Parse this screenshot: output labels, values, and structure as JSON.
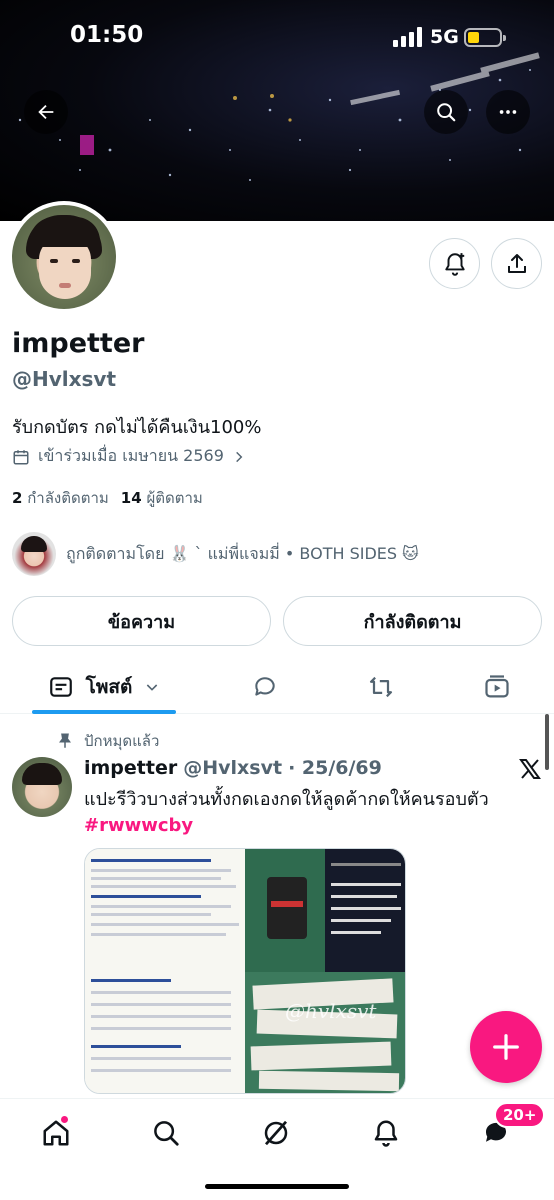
{
  "status_bar": {
    "time": "01:50",
    "network": "5G"
  },
  "profile": {
    "display_name": "impetter",
    "handle": "@Hvlxsvt",
    "bio": "รับกดบัตร กดไม่ได้คืนเงิน100%",
    "joined": "เข้าร่วมเมื่อ เมษายน 2569",
    "following_count": "2",
    "following_label": "กำลังติดตาม",
    "followers_count": "14",
    "followers_label": "ผู้ติดตาม",
    "followed_by": "ถูกติดตามโดย 🐰 ` แม่พี่แจมมี่ • BOTH SIDES 🐱"
  },
  "actions": {
    "message_label": "ข้อความ",
    "following_button_label": "กำลังติดตาม"
  },
  "tabs": [
    {
      "label": "โพสต์",
      "icon": "posts-icon",
      "active": true
    },
    {
      "label": "",
      "icon": "replies-icon"
    },
    {
      "label": "",
      "icon": "reposts-icon"
    },
    {
      "label": "",
      "icon": "media-icon"
    }
  ],
  "pinned_post": {
    "pinned_label": "ปักหมุดแล้ว",
    "author_name": "impetter",
    "author_handle": "@Hvlxsvt",
    "date": "· 25/6/69",
    "text": "แปะรีวิวบางส่วนทั้งกดเองกดให้ลูดค้ากดให้คนรอบตัว",
    "hashtag": "#rwwwcby",
    "media_overlay_text": "@hvlxsvt"
  },
  "bottom_nav": {
    "items": [
      "home-icon",
      "search-icon",
      "grok-icon",
      "notifications-icon",
      "messages-icon"
    ],
    "messages_badge": "20+"
  },
  "colors": {
    "accent": "#1d9bf0",
    "pink": "#f91880",
    "text": "#0f1419",
    "muted": "#536471"
  }
}
